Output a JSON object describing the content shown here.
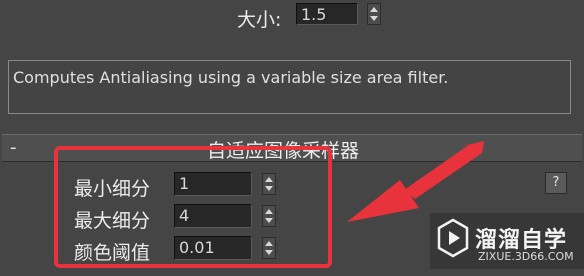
{
  "size_control": {
    "label": "大小:",
    "value": "1.5"
  },
  "description": "Computes Antialiasing using a variable size area filter.",
  "rollout": {
    "toggle": "-",
    "title": "自适应图像采样器"
  },
  "params": [
    {
      "label": "最小细分",
      "value": "1"
    },
    {
      "label": "最大细分",
      "value": "4"
    },
    {
      "label": "颜色阈值",
      "value": "0.01"
    }
  ],
  "help_button": "?",
  "watermark": {
    "title": "溜溜自学",
    "url": "ZIXUE.3D66.COM"
  },
  "colors": {
    "panel_bg": "#454545",
    "annotation_red": "#e8323c"
  }
}
